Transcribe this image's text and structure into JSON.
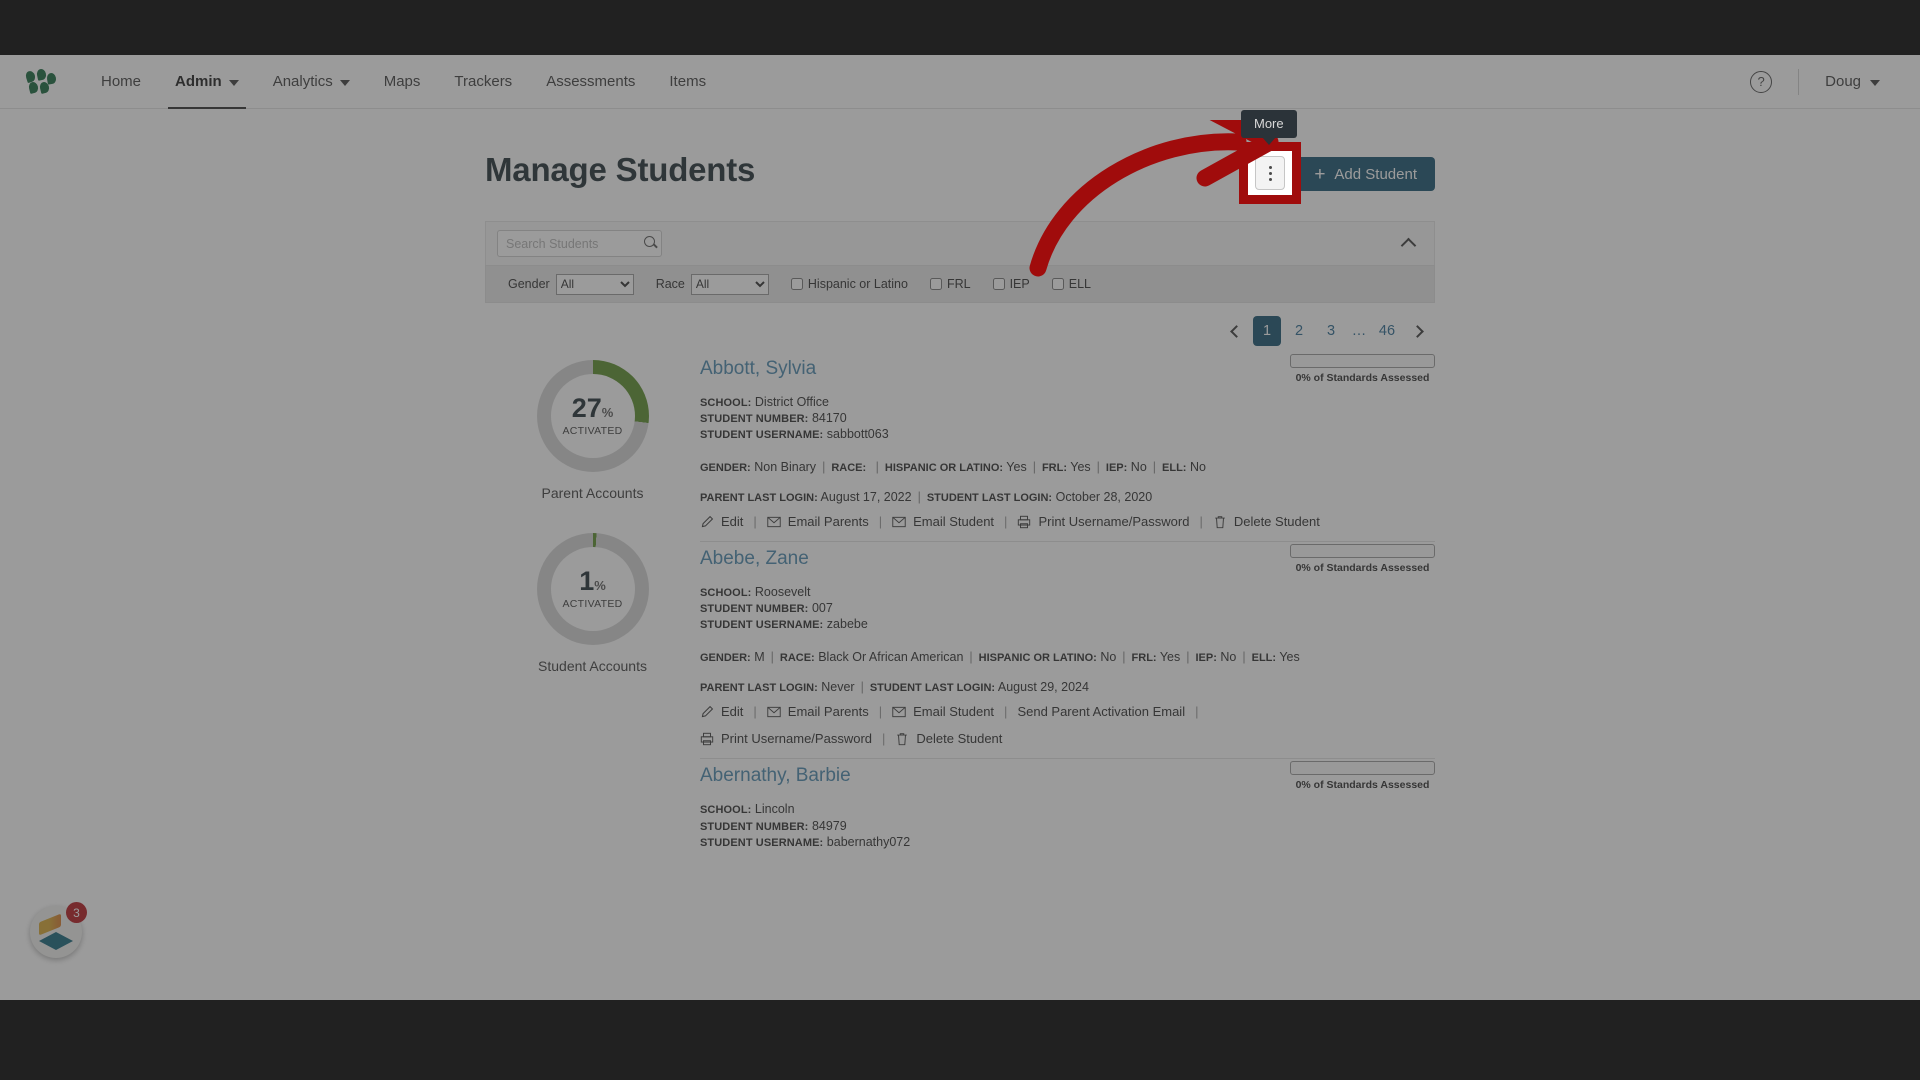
{
  "nav": {
    "logo_icon": "leaves-logo-icon",
    "items": [
      {
        "label": "Home",
        "has_caret": false,
        "active": false
      },
      {
        "label": "Admin",
        "has_caret": true,
        "active": true
      },
      {
        "label": "Analytics",
        "has_caret": true,
        "active": false
      },
      {
        "label": "Maps",
        "has_caret": false,
        "active": false
      },
      {
        "label": "Trackers",
        "has_caret": false,
        "active": false
      },
      {
        "label": "Assessments",
        "has_caret": false,
        "active": false
      },
      {
        "label": "Items",
        "has_caret": false,
        "active": false
      }
    ],
    "help_icon": "question-mark-icon",
    "user": "Doug"
  },
  "header": {
    "title": "Manage Students",
    "more_button_icon": "vertical-ellipsis-icon",
    "more_tooltip": "More",
    "add_button": "Add Student",
    "add_button_icon": "plus-icon",
    "add_button_color": "#15526f"
  },
  "filters": {
    "search_placeholder": "Search Students",
    "search_value": "",
    "search_icon": "search-icon",
    "collapse_icon": "chevron-up-icon",
    "gender_label": "Gender",
    "gender_value": "All",
    "gender_options": [
      "All"
    ],
    "race_label": "Race",
    "race_value": "All",
    "race_options": [
      "All"
    ],
    "checkboxes": [
      {
        "label": "Hispanic or Latino",
        "checked": false
      },
      {
        "label": "FRL",
        "checked": false
      },
      {
        "label": "IEP",
        "checked": false
      },
      {
        "label": "ELL",
        "checked": false
      }
    ]
  },
  "pagination": {
    "prev_icon": "chevron-left-icon",
    "next_icon": "chevron-right-icon",
    "pages": [
      "1",
      "2",
      "3",
      "…",
      "46"
    ],
    "active_page": "1",
    "active_color": "#15526f"
  },
  "stats": [
    {
      "value": "27",
      "unit": "%",
      "sub": "ACTIVATED",
      "label": "Parent Accounts",
      "percent": 27,
      "arc_color": "#5a8f2a",
      "track_color": "#d4d4d4"
    },
    {
      "value": "1",
      "unit": "%",
      "sub": "ACTIVATED",
      "label": "Student Accounts",
      "percent": 1,
      "arc_color": "#5a8f2a",
      "track_color": "#d4d4d4"
    }
  ],
  "field_labels": {
    "school": "SCHOOL:",
    "student_number": "STUDENT NUMBER:",
    "student_username": "STUDENT USERNAME:",
    "gender": "GENDER:",
    "race": "RACE:",
    "hispanic": "HISPANIC OR LATINO:",
    "frl": "FRL:",
    "iep": "IEP:",
    "ell": "ELL:",
    "parent_last_login": "PARENT LAST LOGIN:",
    "student_last_login": "STUDENT LAST LOGIN:"
  },
  "students": [
    {
      "name": "Abbott, Sylvia",
      "school": "District Office",
      "student_number": "84170",
      "student_username": "sabbott063",
      "gender": "Non Binary",
      "race": "",
      "hispanic": "Yes",
      "frl": "Yes",
      "iep": "No",
      "ell": "No",
      "parent_last_login": "August 17, 2022",
      "student_last_login": "October 28, 2020",
      "standards_caption": "0% of Standards Assessed",
      "standards_percent": 0,
      "actions": [
        {
          "label": "Edit",
          "icon": "pencil-icon"
        },
        {
          "label": "Email Parents",
          "icon": "envelope-icon"
        },
        {
          "label": "Email Student",
          "icon": "envelope-icon"
        },
        {
          "label": "Print Username/Password",
          "icon": "printer-icon"
        },
        {
          "label": "Delete Student",
          "icon": "trash-icon"
        }
      ]
    },
    {
      "name": "Abebe, Zane",
      "school": "Roosevelt",
      "student_number": "007",
      "student_username": "zabebe",
      "gender": "M",
      "race": "Black Or African American",
      "hispanic": "No",
      "frl": "Yes",
      "iep": "No",
      "ell": "Yes",
      "parent_last_login": "Never",
      "student_last_login": "August 29, 2024",
      "standards_caption": "0% of Standards Assessed",
      "standards_percent": 0,
      "actions": [
        {
          "label": "Edit",
          "icon": "pencil-icon"
        },
        {
          "label": "Email Parents",
          "icon": "envelope-icon"
        },
        {
          "label": "Email Student",
          "icon": "envelope-icon"
        },
        {
          "label": "Send Parent Activation Email",
          "icon": "none"
        },
        {
          "label": "Print Username/Password",
          "icon": "printer-icon"
        },
        {
          "label": "Delete Student",
          "icon": "trash-icon"
        }
      ]
    },
    {
      "name": "Abernathy, Barbie",
      "school": "Lincoln",
      "student_number": "84979",
      "student_username": "babernathy072",
      "standards_caption": "0% of Standards Assessed",
      "standards_percent": 0
    }
  ],
  "widget": {
    "badge": "3",
    "icon": "diamond-stack-icon"
  },
  "annotation": {
    "arrow_color": "#a00c0c",
    "highlight_color": "#a00c0c"
  }
}
